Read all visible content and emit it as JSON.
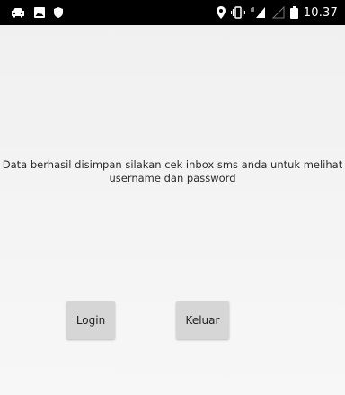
{
  "status_bar": {
    "time": "10.37",
    "left_icons": [
      "car-icon",
      "image-icon",
      "shield-icon"
    ],
    "right_icons": [
      "location-icon",
      "vibrate-icon",
      "signal-icon",
      "signal-empty-icon",
      "battery-icon"
    ]
  },
  "main": {
    "message": "Data berhasil disimpan silakan cek inbox sms anda untuk melihat username dan password",
    "login_label": "Login",
    "keluar_label": "Keluar"
  },
  "colors": {
    "background": "#f3f3f3",
    "status_bar": "#000000",
    "button": "#d6d6d6"
  }
}
